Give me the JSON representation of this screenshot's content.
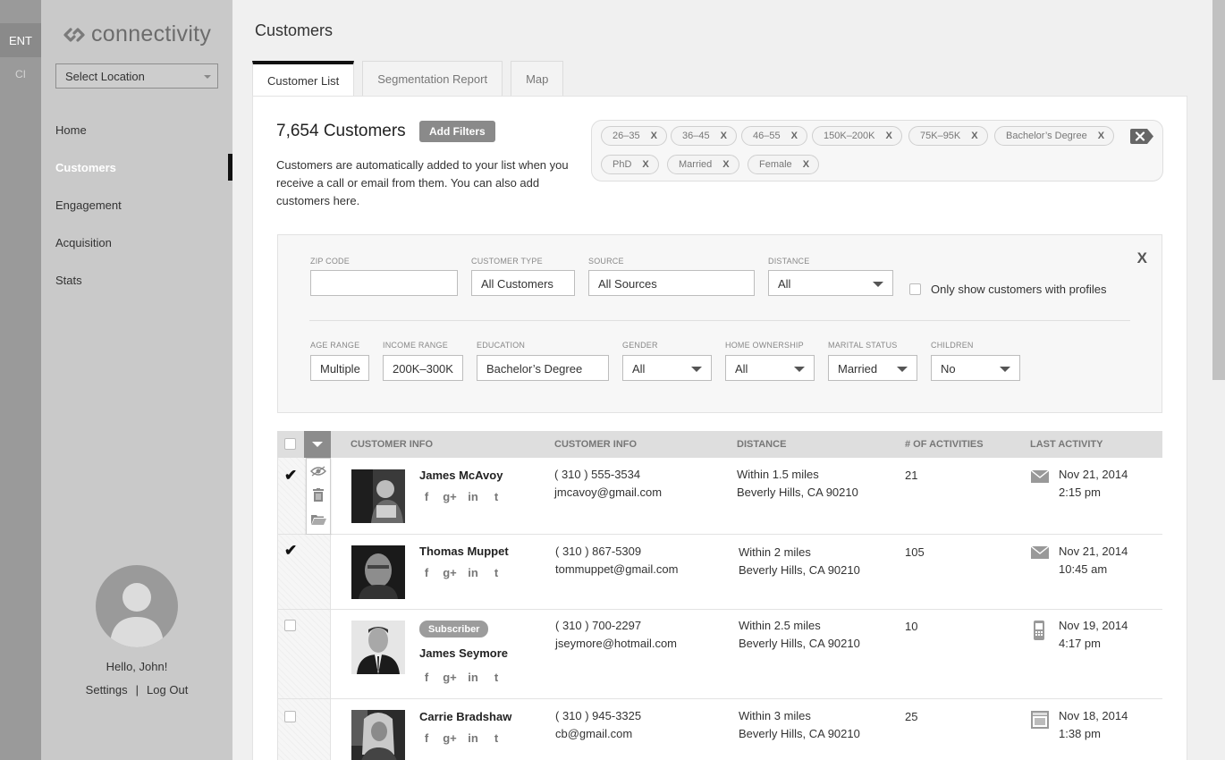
{
  "rail": {
    "items": [
      "ENT",
      "CI"
    ]
  },
  "sidebar": {
    "logo": "connectivity",
    "location_select": "Select Location",
    "nav": [
      "Home",
      "Customers",
      "Engagement",
      "Acquisition",
      "Stats"
    ],
    "active_nav": "Customers",
    "greeting": "Hello, John!",
    "settings": "Settings",
    "separator": "|",
    "logout": "Log Out"
  },
  "page": {
    "title": "Customers",
    "tabs": [
      "Customer List",
      "Segmentation Report",
      "Map"
    ],
    "active_tab": "Customer List"
  },
  "summary": {
    "count": "7,654 Customers",
    "add_filters": "Add Filters",
    "description": "Customers are automatically added to your list when you receive a call or email from them. You can also add customers here."
  },
  "chips": [
    "26–35",
    "36–45",
    "46–55",
    "150K–200K",
    "75K–95K",
    "Bachelor’s Degree",
    "PhD",
    "Married",
    "Female"
  ],
  "chip_remove": "X",
  "filters": {
    "close": "X",
    "zip": {
      "label": "ZIP CODE",
      "value": ""
    },
    "customer_type": {
      "label": "CUSTOMER TYPE",
      "value": "All Customers"
    },
    "source": {
      "label": "SOURCE",
      "value": "All Sources"
    },
    "distance": {
      "label": "DISTANCE",
      "value": "All"
    },
    "profiles_only": "Only show customers with profiles",
    "age_range": {
      "label": "AGE RANGE",
      "value": "Multiple"
    },
    "income_range": {
      "label": "INCOME RANGE",
      "value": "200K–300K"
    },
    "education": {
      "label": "EDUCATION",
      "value": "Bachelor’s Degree"
    },
    "gender": {
      "label": "GENDER",
      "value": "All"
    },
    "home_ownership": {
      "label": "HOME OWNERSHIP",
      "value": "All"
    },
    "marital_status": {
      "label": "MARITAL STATUS",
      "value": "Married"
    },
    "children": {
      "label": "CHILDREN",
      "value": "No"
    }
  },
  "table": {
    "headers": [
      "CUSTOMER INFO",
      "CUSTOMER INFO",
      "DISTANCE",
      "# OF ACTIVITIES",
      "LAST ACTIVITY"
    ],
    "social": [
      "f",
      "g+",
      "in",
      "t"
    ],
    "rows": [
      {
        "name": "James McAvoy",
        "phone": "( 310 ) 555-3534",
        "email": "jmcavoy@gmail.com",
        "distance": "Within 1.5 miles",
        "location": "Beverly Hills, CA 90210",
        "activities": "21",
        "date": "Nov 21, 2014",
        "time": "2:15 pm",
        "icon": "mail-icon",
        "checked": true,
        "badge": ""
      },
      {
        "name": "Thomas Muppet",
        "phone": "( 310 ) 867-5309",
        "email": "tommuppet@gmail.com",
        "distance": "Within 2 miles",
        "location": "Beverly Hills, CA 90210",
        "activities": "105",
        "date": "Nov 21, 2014",
        "time": "10:45 am",
        "icon": "mail-icon",
        "checked": true,
        "badge": ""
      },
      {
        "name": "James Seymore",
        "phone": "( 310 ) 700-2297",
        "email": "jseymore@hotmail.com",
        "distance": "Within 2.5 miles",
        "location": "Beverly Hills, CA 90210",
        "activities": "10",
        "date": "Nov 19, 2014",
        "time": "4:17 pm",
        "icon": "phone-icon",
        "checked": false,
        "badge": "Subscriber"
      },
      {
        "name": "Carrie Bradshaw",
        "phone": "( 310 ) 945-3325",
        "email": "cb@gmail.com",
        "distance": "Within 3 miles",
        "location": "Beverly Hills, CA 90210",
        "activities": "25",
        "date": "Nov 18, 2014",
        "time": "1:38 pm",
        "icon": "web-icon",
        "checked": false,
        "badge": ""
      }
    ]
  },
  "colors": {
    "accent": "#111111",
    "sidebar": "#c9c9c9",
    "rail": "#9a9a9a",
    "button": "#8a8a8a"
  }
}
